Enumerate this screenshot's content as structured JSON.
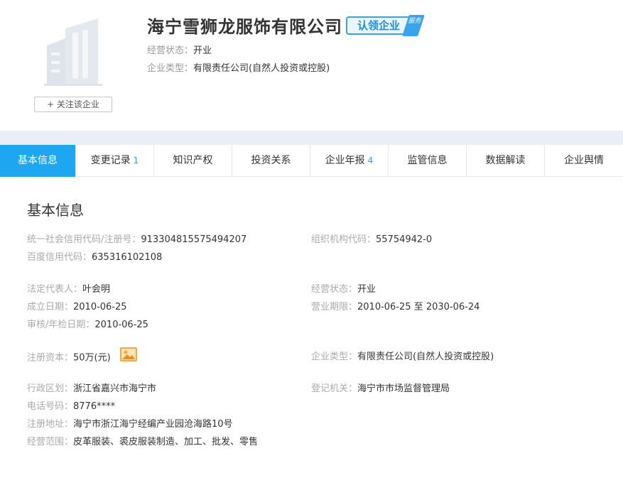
{
  "header": {
    "company_name": "海宁雪狮龙服饰有限公司",
    "claim_badge": "认领企业",
    "claim_tag": "服务",
    "status_label": "经营状态：",
    "status_value": "开业",
    "type_label": "企业类型：",
    "type_value": "有限责任公司(自然人投资或控股)",
    "follow_button": "+ 关注该企业"
  },
  "tabs": [
    {
      "label": "基本信息",
      "count": ""
    },
    {
      "label": "变更记录",
      "count": "1"
    },
    {
      "label": "知识产权",
      "count": ""
    },
    {
      "label": "投资关系",
      "count": ""
    },
    {
      "label": "企业年报",
      "count": "4"
    },
    {
      "label": "监管信息",
      "count": ""
    },
    {
      "label": "数据解读",
      "count": ""
    },
    {
      "label": "企业舆情",
      "count": ""
    }
  ],
  "basic": {
    "title": "基本信息",
    "credit_code_label": "统一社会信用代码/注册号：",
    "credit_code": "913304815575494207",
    "org_code_label": "组织机构代码：",
    "org_code": "55754942-0",
    "baidu_code_label": "百度信用代码：",
    "baidu_code": "635316102108",
    "legal_rep_label": "法定代表人：",
    "legal_rep": "叶会明",
    "status_label": "经营状态：",
    "status": "开业",
    "founded_label": "成立日期：",
    "founded": "2010-06-25",
    "term_label": "营业期限：",
    "term": "2010-06-25 至 2030-06-24",
    "audit_label": "审核/年检日期：",
    "audit": "2010-06-25",
    "capital_label": "注册资本：",
    "capital": "50万(元)",
    "type_label": "企业类型：",
    "type": "有限责任公司(自然人投资或控股)",
    "region_label": "行政区划：",
    "region": "浙江省嘉兴市海宁市",
    "authority_label": "登记机关：",
    "authority": "海宁市市场监督管理局",
    "phone_label": "电话号码：",
    "phone": "8776****",
    "address_label": "注册地址：",
    "address": "海宁市浙江海宁经编产业园沧海路10号",
    "scope_label": "经营范围：",
    "scope": "皮革服装、裘皮服装制造、加工、批发、零售"
  },
  "colors": {
    "accent": "#1ea7f0",
    "band": "#eaeff7",
    "label_gray": "#aaaaaa"
  }
}
